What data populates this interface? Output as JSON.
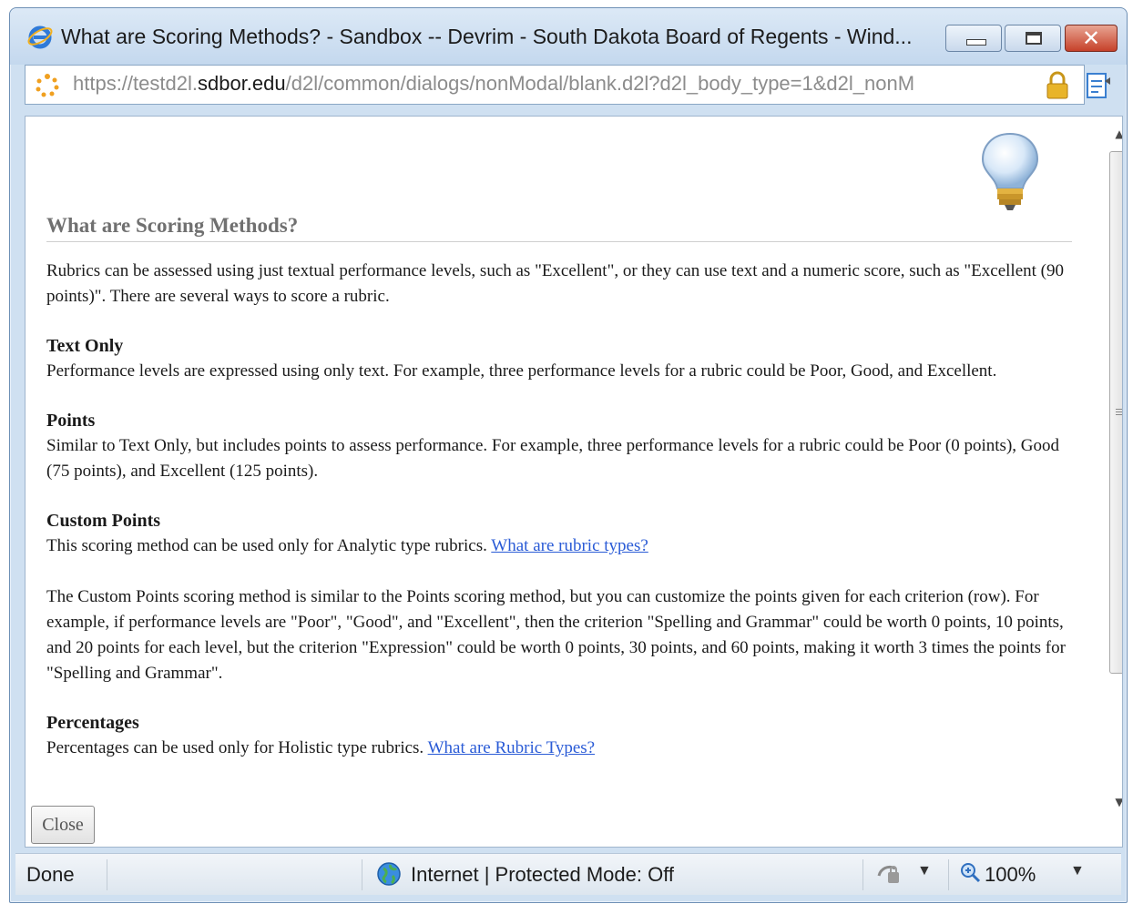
{
  "window": {
    "title": "What are Scoring Methods? - Sandbox -- Devrim - South Dakota Board of Regents - Wind...",
    "close_glyph": "✕"
  },
  "address": {
    "scheme": "https://",
    "sub": "testd2l.",
    "domain": "sdbor.edu",
    "path": "/d2l/common/dialogs/nonModal/blank.d2l?d2l_body_type=1&d2l_nonM"
  },
  "content": {
    "title": "What are Scoring Methods?",
    "intro": "Rubrics can be assessed using just textual performance levels, such as \"Excellent\", or they can use text and a numeric score, such as \"Excellent (90 points)\". There are several ways to score a rubric.",
    "text_only": {
      "heading": "Text Only",
      "body": "Performance levels are expressed using only text. For example, three performance levels for a rubric could be Poor, Good, and Excellent."
    },
    "points": {
      "heading": "Points",
      "body": "Similar to Text Only, but includes points to assess performance. For example, three performance levels for a rubric could be Poor (0 points), Good (75 points), and Excellent (125 points)."
    },
    "custom_points": {
      "heading": "Custom Points",
      "body": "This scoring method can be used only for Analytic type rubrics.",
      "link": "What are rubric types?",
      "detail": "The Custom Points scoring method is similar to the Points scoring method, but you can customize the points given for each criterion (row). For example, if performance levels are \"Poor\", \"Good\", and \"Excellent\", then the criterion \"Spelling and Grammar\" could be worth 0 points, 10 points, and 20 points for each level, but the criterion \"Expression\" could be worth 0 points, 30 points, and 60 points, making it worth 3 times the points for \"Spelling and Grammar\"."
    },
    "percentages": {
      "heading": "Percentages",
      "body": "Percentages can be used only for Holistic type rubrics.",
      "link": "What are Rubric Types?"
    }
  },
  "buttons": {
    "close": "Close"
  },
  "status": {
    "done": "Done",
    "zone": "Internet | Protected Mode: Off",
    "zoom": "100%"
  },
  "colors": {
    "link": "#2a5bd6",
    "close_button_red": "#c6412a",
    "chrome_blue": "#c4d8ee"
  }
}
